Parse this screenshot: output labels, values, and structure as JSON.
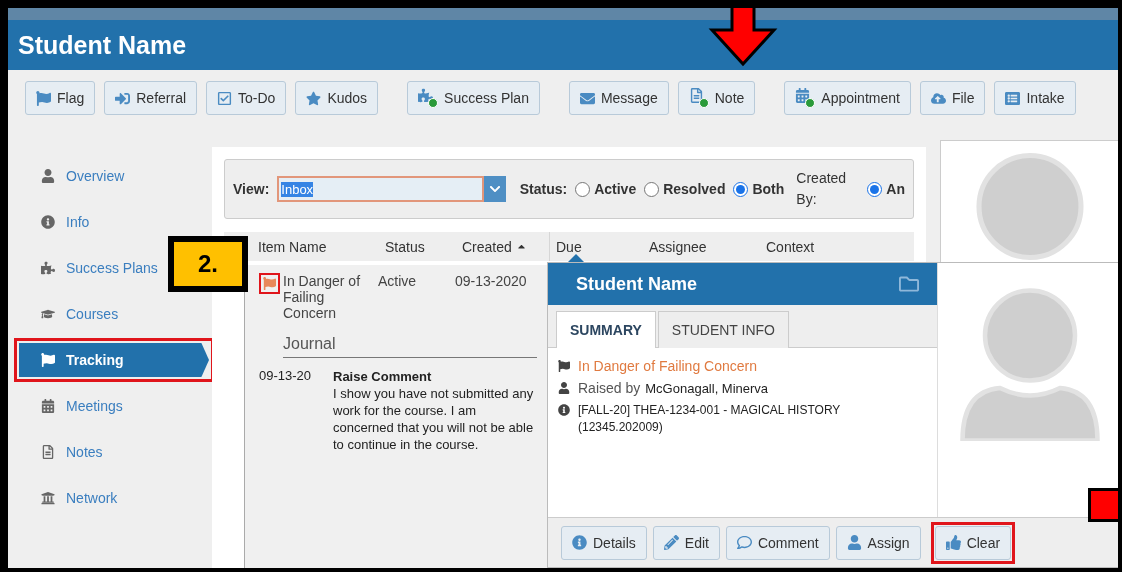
{
  "header": {
    "title": "Student Name"
  },
  "toolbar": {
    "groups": [
      [
        {
          "label": "Flag",
          "plus": false
        },
        {
          "label": "Referral",
          "plus": false
        },
        {
          "label": "To-Do",
          "plus": false
        },
        {
          "label": "Kudos",
          "plus": false
        }
      ],
      [
        {
          "label": "Success Plan",
          "plus": true
        }
      ],
      [
        {
          "label": "Message",
          "plus": false
        },
        {
          "label": "Note",
          "plus": true
        }
      ],
      [
        {
          "label": "Appointment",
          "plus": true
        },
        {
          "label": "File",
          "plus": false
        },
        {
          "label": "Intake",
          "plus": false
        }
      ]
    ]
  },
  "sidebar": {
    "items": [
      {
        "label": "Overview",
        "selected": false,
        "highlighted": false
      },
      {
        "label": "Info",
        "selected": false,
        "highlighted": false
      },
      {
        "label": "Success Plans",
        "selected": false,
        "highlighted": false
      },
      {
        "label": "Courses",
        "selected": false,
        "highlighted": false
      },
      {
        "label": "Tracking",
        "selected": true,
        "highlighted": true
      },
      {
        "label": "Meetings",
        "selected": false,
        "highlighted": false
      },
      {
        "label": "Notes",
        "selected": false,
        "highlighted": false
      },
      {
        "label": "Network",
        "selected": false,
        "highlighted": false
      }
    ]
  },
  "filter": {
    "view_label": "View:",
    "view_value": "Inbox",
    "status_label": "Status:",
    "status_options": [
      {
        "label": "Active",
        "selected": false
      },
      {
        "label": "Resolved",
        "selected": false
      },
      {
        "label": "Both",
        "selected": true
      }
    ],
    "created_by_label": "Created By:",
    "created_by_options": [
      {
        "label": "An",
        "selected": true
      }
    ]
  },
  "table": {
    "columns": [
      {
        "label": "Item Name",
        "sorted": false
      },
      {
        "label": "Status",
        "sorted": false
      },
      {
        "label": "Created",
        "sorted": true
      },
      {
        "label": "Due",
        "sorted": false
      },
      {
        "label": "Assignee",
        "sorted": false
      },
      {
        "label": "Context",
        "sorted": false
      }
    ],
    "rows": [
      {
        "item_name": "In Danger of Failing Concern",
        "flag_highlighted": true,
        "status": "Active",
        "created": "09-13-2020",
        "journal": {
          "title": "Journal",
          "entries": [
            {
              "date": "09-13-20",
              "title": "Raise Comment",
              "text": "I show you have not submitted any work for the course. I am concerned that you will not be able to continue in the course."
            }
          ]
        }
      }
    ]
  },
  "popup": {
    "title": "Student Name",
    "tabs": [
      {
        "label": "SUMMARY",
        "selected": true
      },
      {
        "label": "STUDENT INFO",
        "selected": false
      }
    ],
    "concern": "In Danger of Failing Concern",
    "raised_by_label": "Raised by",
    "raised_by": "McGonagall, Minerva",
    "course": "[FALL-20] THEA-1234-001 - MAGICAL HISTORY (12345.202009)",
    "buttons": [
      {
        "label": "Details",
        "highlighted": false
      },
      {
        "label": "Edit",
        "highlighted": false
      },
      {
        "label": "Comment",
        "highlighted": false
      },
      {
        "label": "Assign",
        "highlighted": false
      },
      {
        "label": "Clear",
        "highlighted": true
      }
    ]
  },
  "annotations": [
    {
      "kind": "arrow"
    },
    {
      "kind": "step",
      "label": "2."
    },
    {
      "kind": "block"
    }
  ]
}
